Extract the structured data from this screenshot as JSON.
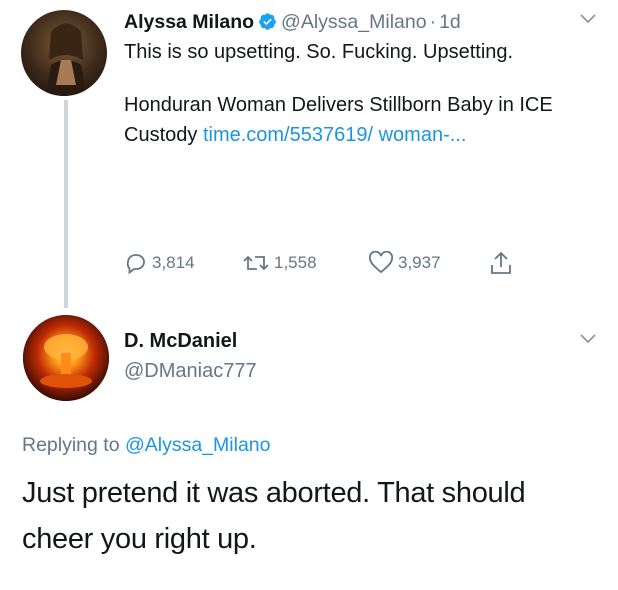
{
  "tweet": {
    "author_name": "Alyssa Milano",
    "author_handle": "@Alyssa_Milano",
    "separator": "·",
    "time": "1d",
    "text": "This is so upsetting. So. Fucking. Upsetting.",
    "link_headline": "Honduran Woman Delivers Stillborn Baby in ICE Custody",
    "link_url": "time.com/5537619/ woman-...",
    "reply_count": "3,814",
    "retweet_count": "1,558",
    "like_count": "3,937"
  },
  "reply": {
    "author_name": "D. McDaniel",
    "author_handle": "@DManiac777",
    "replying_prefix": "Replying to",
    "replying_to": "@Alyssa_Milano",
    "text": "Just pretend it was aborted. That should cheer you right up."
  },
  "colors": {
    "text": "#14171a",
    "secondary": "#657786",
    "link": "#1b95e0",
    "verified": "#1da1f2",
    "thread_line": "#ccd6dd"
  },
  "icons": [
    "verified-badge-icon",
    "caret-down-icon",
    "reply-icon",
    "retweet-icon",
    "like-icon",
    "share-icon"
  ]
}
